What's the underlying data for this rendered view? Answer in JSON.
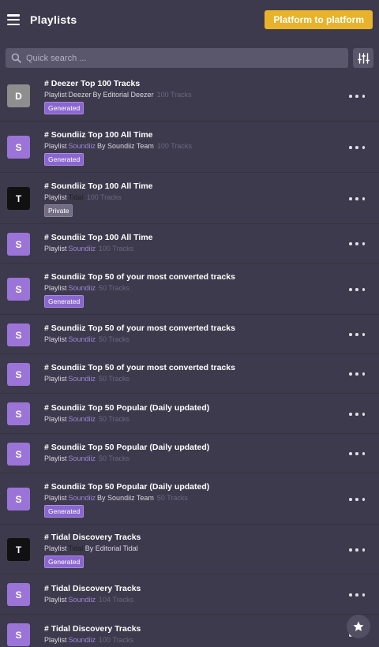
{
  "header": {
    "title": "Playlists",
    "cta_label": "Platform to platform"
  },
  "search": {
    "placeholder": "Quick search ..."
  },
  "colors": {
    "deezer": "#8e8e8e",
    "soundiiz": "#9b74d8",
    "tidal": "#111111",
    "cta": "#e8b32a",
    "background": "#3e3a4d"
  },
  "playlists": [
    {
      "initial": "D",
      "service_color": "#8e8e8e",
      "name": "# Deezer Top 100 Tracks",
      "type": "Playlist",
      "service": "Deezer",
      "service_text_color": "#d9d6e2",
      "by": "By Editorial Deezer",
      "tracks": "100 Tracks",
      "badge": "Generated",
      "badge_type": "generated"
    },
    {
      "initial": "S",
      "service_color": "#9b74d8",
      "name": "# Soundiiz Top 100 All Time",
      "type": "Playlist",
      "service": "Soundiiz",
      "service_text_color": "#9c87d6",
      "by": "By Soundiiz Team",
      "tracks": "100 Tracks",
      "badge": "Generated",
      "badge_type": "generated"
    },
    {
      "initial": "T",
      "service_color": "#111111",
      "name": "# Soundiiz Top 100 All Time",
      "type": "Playlist",
      "service": "Tidal",
      "service_text_color": "#222222",
      "by": "",
      "tracks": "100 Tracks",
      "badge": "Private",
      "badge_type": "private"
    },
    {
      "initial": "S",
      "service_color": "#9b74d8",
      "name": "# Soundiiz Top 100 All Time",
      "type": "Playlist",
      "service": "Soundiiz",
      "service_text_color": "#9c87d6",
      "by": "",
      "tracks": "100 Tracks",
      "badge": "",
      "badge_type": ""
    },
    {
      "initial": "S",
      "service_color": "#9b74d8",
      "name": "# Soundiiz Top 50 of your most converted tracks",
      "type": "Playlist",
      "service": "Soundiiz",
      "service_text_color": "#9c87d6",
      "by": "",
      "tracks": "50 Tracks",
      "badge": "Generated",
      "badge_type": "generated"
    },
    {
      "initial": "S",
      "service_color": "#9b74d8",
      "name": "# Soundiiz Top 50 of your most converted tracks",
      "type": "Playlist",
      "service": "Soundiiz",
      "service_text_color": "#9c87d6",
      "by": "",
      "tracks": "50 Tracks",
      "badge": "",
      "badge_type": ""
    },
    {
      "initial": "S",
      "service_color": "#9b74d8",
      "name": "# Soundiiz Top 50 of your most converted tracks",
      "type": "Playlist",
      "service": "Soundiiz",
      "service_text_color": "#9c87d6",
      "by": "",
      "tracks": "50 Tracks",
      "badge": "",
      "badge_type": ""
    },
    {
      "initial": "S",
      "service_color": "#9b74d8",
      "name": "# Soundiiz Top 50 Popular (Daily updated)",
      "type": "Playlist",
      "service": "Soundiiz",
      "service_text_color": "#9c87d6",
      "by": "",
      "tracks": "50 Tracks",
      "badge": "",
      "badge_type": ""
    },
    {
      "initial": "S",
      "service_color": "#9b74d8",
      "name": "# Soundiiz Top 50 Popular (Daily updated)",
      "type": "Playlist",
      "service": "Soundiiz",
      "service_text_color": "#9c87d6",
      "by": "",
      "tracks": "50 Tracks",
      "badge": "",
      "badge_type": ""
    },
    {
      "initial": "S",
      "service_color": "#9b74d8",
      "name": "# Soundiiz Top 50 Popular (Daily updated)",
      "type": "Playlist",
      "service": "Soundiiz",
      "service_text_color": "#9c87d6",
      "by": "By Soundiiz Team",
      "tracks": "50 Tracks",
      "badge": "Generated",
      "badge_type": "generated"
    },
    {
      "initial": "T",
      "service_color": "#111111",
      "name": "# Tidal Discovery Tracks",
      "type": "Playlist",
      "service": "Tidal",
      "service_text_color": "#222222",
      "by": "By Editorial Tidal",
      "tracks": "",
      "badge": "Generated",
      "badge_type": "generated"
    },
    {
      "initial": "S",
      "service_color": "#9b74d8",
      "name": "# Tidal Discovery Tracks",
      "type": "Playlist",
      "service": "Soundiiz",
      "service_text_color": "#9c87d6",
      "by": "",
      "tracks": "104 Tracks",
      "badge": "",
      "badge_type": ""
    },
    {
      "initial": "S",
      "service_color": "#9b74d8",
      "name": "# Tidal Discovery Tracks",
      "type": "Playlist",
      "service": "Soundiiz",
      "service_text_color": "#9c87d6",
      "by": "",
      "tracks": "100 Tracks",
      "badge": "",
      "badge_type": ""
    }
  ]
}
